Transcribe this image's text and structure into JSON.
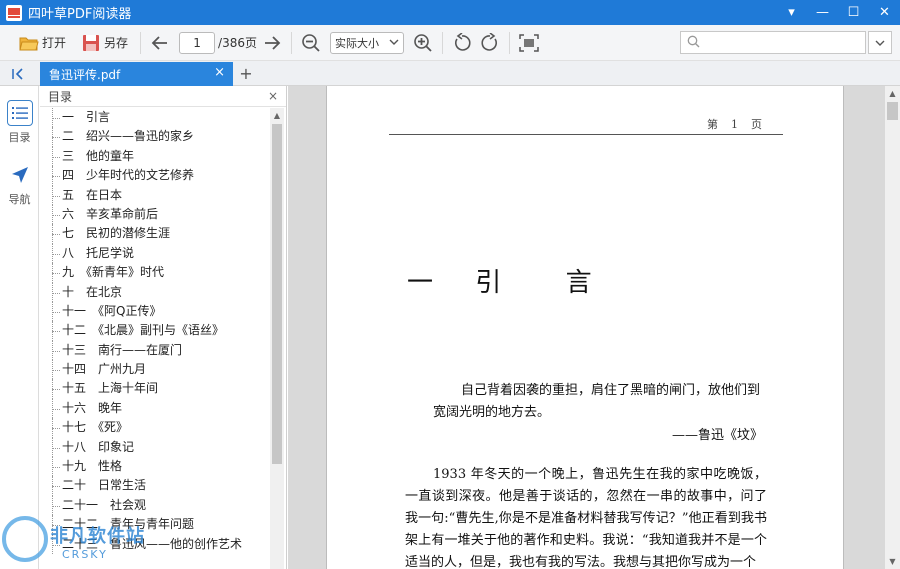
{
  "window": {
    "title": "四叶草PDF阅读器",
    "controls": [
      "▾",
      "—",
      "☐",
      "✕"
    ]
  },
  "toolbar": {
    "open_label": "打开",
    "saveas_label": "另存",
    "page_current": "1",
    "page_total": "/386页",
    "zoom_value": "实际大小",
    "search_placeholder": ""
  },
  "tab": {
    "filename": "鲁迅评传.pdf",
    "close": "×",
    "add": "+"
  },
  "rail": {
    "outline_label": "目录",
    "nav_label": "导航"
  },
  "outline": {
    "header": "目录",
    "close": "×",
    "items": [
      "一　引言",
      "二　绍兴——鲁迅的家乡",
      "三　他的童年",
      "四　少年时代的文艺修养",
      "五　在日本",
      "六　辛亥革命前后",
      "七　民初的潜修生涯",
      "八　托尼学说",
      "九　《新青年》时代",
      "十　在北京",
      "十一　《阿Q正传》",
      "十二　《北晨》副刊与《语丝》",
      "十三　南行——在厦门",
      "十四　广州九月",
      "十五　上海十年间",
      "十六　晚年",
      "十七　《死》",
      "十八　印象记",
      "十九　性格",
      "二十　日常生活",
      "二十一　社会观",
      "二十二　青年与青年问题",
      "二十三　鲁迅风——他的创作艺术"
    ]
  },
  "page": {
    "header": "第　1　页",
    "chapter_title": [
      "一",
      "引",
      "言"
    ],
    "epigraph": "自己背着因袭的重担，肩住了黑暗的闸门，放他们到宽阔光明的地方去。",
    "epigraph_source": "——鲁迅《坟》",
    "body": "1933 年冬天的一个晚上，鲁迅先生在我的家中吃晚饭，一直谈到深夜。他是善于谈话的，忽然在一串的故事中，问了我一句:“曹先生,你是不是准备材料替我写传记？”他正看到我书架上有一堆关于他的著作和史料。我说：“我知道我并不是一个适当的人，但是，我也有我的写法。我想与其把你写成为一个"
  },
  "watermark": {
    "text": "非凡软件站",
    "sub": "CRSKY"
  }
}
